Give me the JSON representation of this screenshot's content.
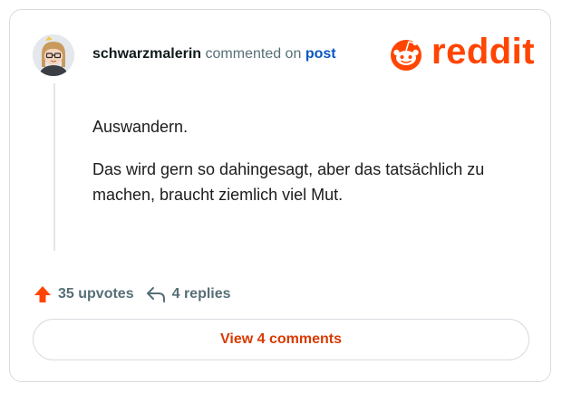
{
  "comment": {
    "username": "schwarzmalerin",
    "action_text": "commented on",
    "post_link": "post",
    "paragraphs": [
      "Auswandern.",
      "Das wird gern so dahingesagt, aber das tatsächlich zu machen, braucht ziemlich viel Mut."
    ]
  },
  "brand": {
    "wordmark": "reddit",
    "icon": "reddit-snoo-icon",
    "color": "#ff4500"
  },
  "stats": {
    "upvotes_label": "35 upvotes",
    "upvote_icon": "upvote-arrow-icon",
    "upvote_color": "#ff4500",
    "replies_label": "4 replies",
    "reply_icon": "reply-arrow-icon"
  },
  "actions": {
    "view_comments_label": "View 4 comments",
    "accent": "#d93a00"
  }
}
